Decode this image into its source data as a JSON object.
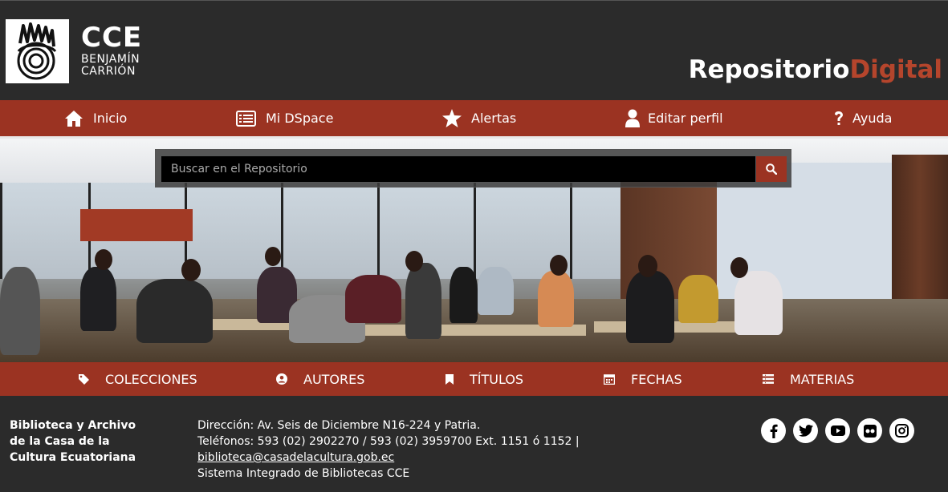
{
  "header": {
    "logo_main": "CCE",
    "logo_line1": "BENJAMÍN",
    "logo_line2": "CARRIÓN",
    "title_part1": "Repositorio",
    "title_part2": "Digital"
  },
  "nav": {
    "items": [
      {
        "label": "Inicio",
        "icon": "home-icon"
      },
      {
        "label": "Mi DSpace",
        "icon": "list-card-icon"
      },
      {
        "label": "Alertas",
        "icon": "star-icon"
      },
      {
        "label": "Editar perfil",
        "icon": "user-icon"
      },
      {
        "label": "Ayuda",
        "icon": "question-icon"
      }
    ]
  },
  "search": {
    "placeholder": "Buscar en el Repositorio",
    "button_icon": "search-icon"
  },
  "browse": {
    "items": [
      {
        "label": "COLECCIONES",
        "icon": "tag-icon"
      },
      {
        "label": "AUTORES",
        "icon": "user-circle-icon"
      },
      {
        "label": "TÍTULOS",
        "icon": "bookmark-icon"
      },
      {
        "label": "FECHAS",
        "icon": "calendar-icon"
      },
      {
        "label": "MATERIAS",
        "icon": "list-icon"
      }
    ]
  },
  "footer": {
    "org_line1": "Biblioteca y Archivo",
    "org_line2": "de la Casa de la",
    "org_line3": "Cultura Ecuatoriana",
    "address": "Dirección: Av. Seis de Diciembre N16-224 y Patria.",
    "phones": "Teléfonos: 593 (02) 2902270 / 593 (02) 3959700 Ext. 1151 ó 1152 |",
    "email": "biblioteca@casadelacultura.gob.ec",
    "system": "Sistema Integrado de Bibliotecas CCE",
    "social": [
      "facebook-icon",
      "twitter-icon",
      "youtube-icon",
      "flickr-icon",
      "instagram-icon"
    ]
  },
  "colors": {
    "brand_red": "#9b3322",
    "title_accent": "#b5452c",
    "background": "#2b2b2b"
  }
}
